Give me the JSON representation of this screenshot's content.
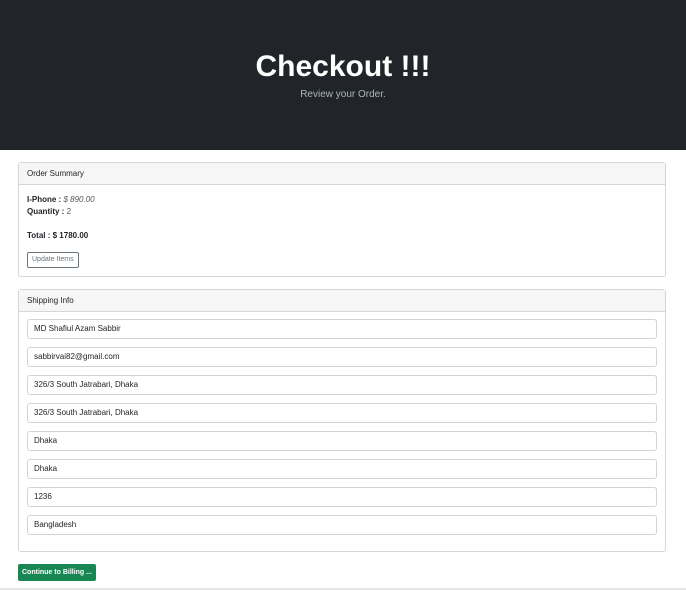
{
  "hero": {
    "title": "Checkout !!!",
    "subtitle": "Review your Order."
  },
  "order_summary": {
    "header": "Order Summary",
    "item_name": "I-Phone :",
    "item_price": "$ 890.00",
    "quantity_label": "Quantity :",
    "quantity_value": "2",
    "total_label": "Total : $ 1780.00",
    "update_button": "Update Items"
  },
  "shipping": {
    "header": "Shipping Info",
    "fields": [
      "MD Shafiul Azam Sabbir",
      "sabbirvai82@gmail.com",
      "326/3 South Jatrabari, Dhaka",
      "326/3 South Jatrabari, Dhaka",
      "Dhaka",
      "Dhaka",
      "1236",
      "Bangladesh"
    ]
  },
  "continue_button": "Continue to Billing ...",
  "colors": {
    "hero_bg": "#212529",
    "success": "#198754"
  }
}
